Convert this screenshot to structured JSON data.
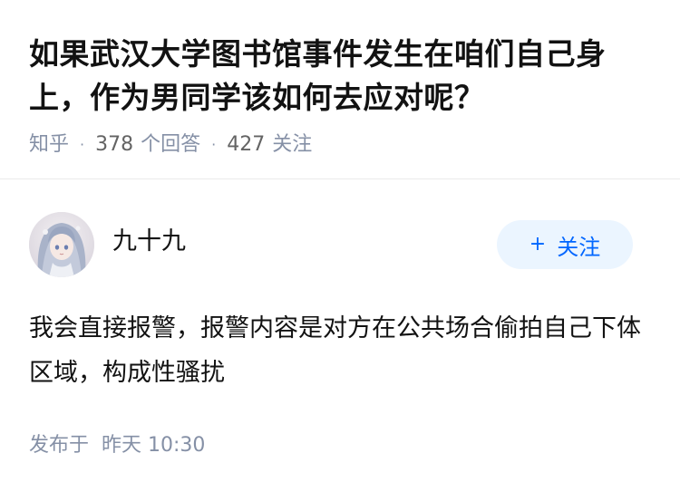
{
  "question": {
    "title": "如果武汉大学图书馆事件发生在咱们自己身上，作为男同学该如何去应对呢？",
    "source": "知乎",
    "answers_count": "378",
    "answers_label": "个回答",
    "followers_count": "427",
    "followers_label": "关注"
  },
  "answer": {
    "author_name": "九十九",
    "follow_button": {
      "icon": "plus-icon",
      "label": "关注"
    },
    "content": "我会直接报警，报警内容是对方在公共场合偷拍自己下体区域，构成性骚扰",
    "published_label": "发布于",
    "published_time": "昨天 10:30"
  },
  "colors": {
    "title": "#121212",
    "meta": "#8590a6",
    "follow_bg": "#ebf5ff",
    "follow_text": "#0066ff",
    "divider": "#ebebeb"
  }
}
